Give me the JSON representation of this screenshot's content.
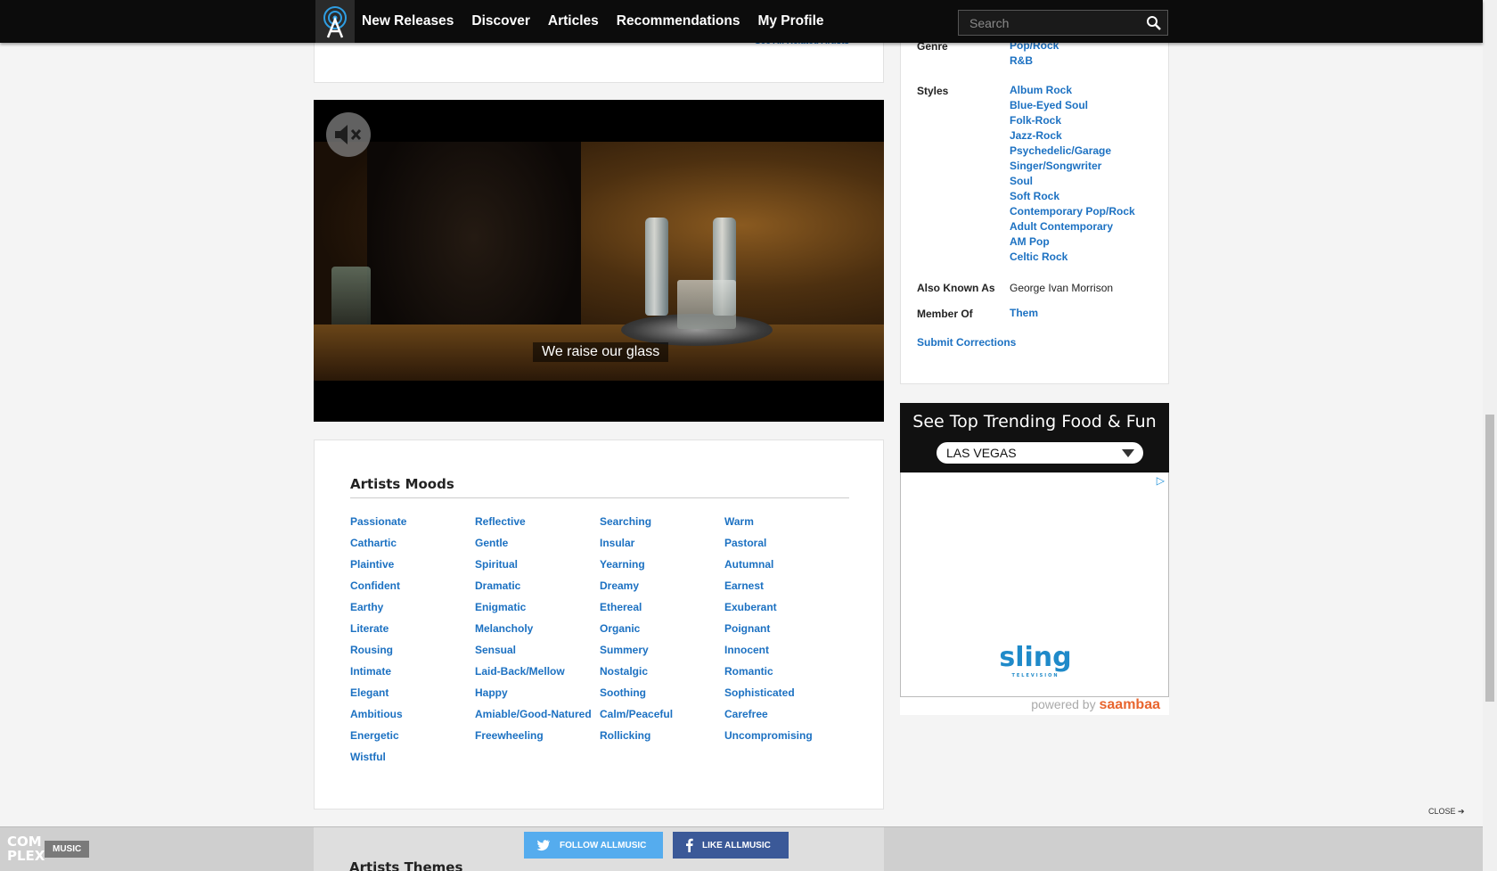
{
  "nav": {
    "items": [
      "New Releases",
      "Discover",
      "Articles",
      "Recommendations",
      "My Profile"
    ],
    "search_placeholder": "Search"
  },
  "top_panel": {
    "link": "See All Related Artists"
  },
  "video": {
    "caption": "We raise our glass"
  },
  "moods": {
    "title": "Artists Moods",
    "items": [
      "Passionate",
      "Reflective",
      "Searching",
      "Warm",
      "Cathartic",
      "Gentle",
      "Insular",
      "Pastoral",
      "Plaintive",
      "Spiritual",
      "Yearning",
      "Autumnal",
      "Confident",
      "Dramatic",
      "Dreamy",
      "Earnest",
      "Earthy",
      "Enigmatic",
      "Ethereal",
      "Exuberant",
      "Literate",
      "Melancholy",
      "Organic",
      "Poignant",
      "Rousing",
      "Sensual",
      "Summery",
      "Innocent",
      "Intimate",
      "Laid-Back/Mellow",
      "Nostalgic",
      "Romantic",
      "Elegant",
      "Happy",
      "Soothing",
      "Sophisticated",
      "Ambitious",
      "Amiable/Good-Natured",
      "Calm/Peaceful",
      "Carefree",
      "Energetic",
      "Freewheeling",
      "Rollicking",
      "Uncompromising",
      "Wistful"
    ]
  },
  "sidebar": {
    "genre_label": "Genre",
    "genres": [
      "Pop/Rock",
      "R&B"
    ],
    "styles_label": "Styles",
    "styles": [
      "Album Rock",
      "Blue-Eyed Soul",
      "Folk-Rock",
      "Jazz-Rock",
      "Psychedelic/Garage",
      "Singer/Songwriter",
      "Soul",
      "Soft Rock",
      "Contemporary Pop/Rock",
      "Adult Contemporary",
      "AM Pop",
      "Celtic Rock"
    ],
    "aka_label": "Also Known As",
    "aka_value": "George Ivan Morrison",
    "member_label": "Member Of",
    "member_value": "Them",
    "submit": "Submit Corrections"
  },
  "ad": {
    "title": "See Top Trending Food & Fun",
    "city": "LAS VEGAS",
    "brand": "sling",
    "brand_sub": "TELEVISION",
    "powered_prefix": "powered by",
    "powered_brand": "saambaa"
  },
  "bottom_bar": {
    "logo_text": "COM PLEX",
    "tag": "MUSIC",
    "twitter": "FOLLOW ALLMUSIC",
    "facebook": "LIKE ALLMUSIC",
    "close": "CLOSE",
    "next_section": "Artists Themes"
  }
}
